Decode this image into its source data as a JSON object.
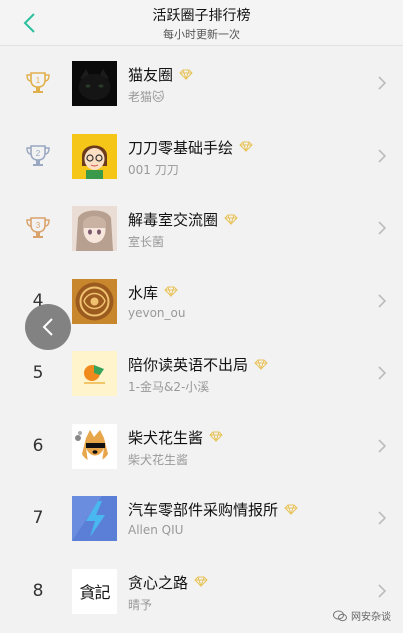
{
  "header": {
    "title": "活跃圈子排行榜",
    "subtitle": "每小时更新一次",
    "accent": "#2bbf9e"
  },
  "rankings": [
    {
      "rank": "1",
      "trophy": "gold",
      "name": "猫友圈",
      "owner": "老猫🐱",
      "avatar": "black-cat"
    },
    {
      "rank": "2",
      "trophy": "silver",
      "name": "刀刀零基础手绘",
      "owner": "001 刀刀",
      "avatar": "cartoon-girl"
    },
    {
      "rank": "3",
      "trophy": "bronze",
      "name": "解毒室交流圈",
      "owner": "室长菌",
      "avatar": "anime-girl"
    },
    {
      "rank": "4",
      "trophy": "",
      "name": "水库",
      "owner": "yevon_ou",
      "avatar": "ornament"
    },
    {
      "rank": "5",
      "trophy": "",
      "name": "陪你读英语不出局",
      "owner": "1-金马&2-小溪",
      "avatar": "logo-orange"
    },
    {
      "rank": "6",
      "trophy": "",
      "name": "柴犬花生酱",
      "owner": "柴犬花生酱",
      "avatar": "shiba"
    },
    {
      "rank": "7",
      "trophy": "",
      "name": "汽车零部件采购情报所",
      "owner": "Allen QIU",
      "avatar": "blue-bolt"
    },
    {
      "rank": "8",
      "trophy": "",
      "name": "贪心之路",
      "owner": "晴予",
      "avatar": "calligraphy"
    }
  ],
  "calligraphy_text": "貪記",
  "watermark": "网安杂谈",
  "colors": {
    "gold": "#e1b04d",
    "silver": "#9aa8c2",
    "bronze": "#d9a36b",
    "gem": "#e8c35a"
  }
}
